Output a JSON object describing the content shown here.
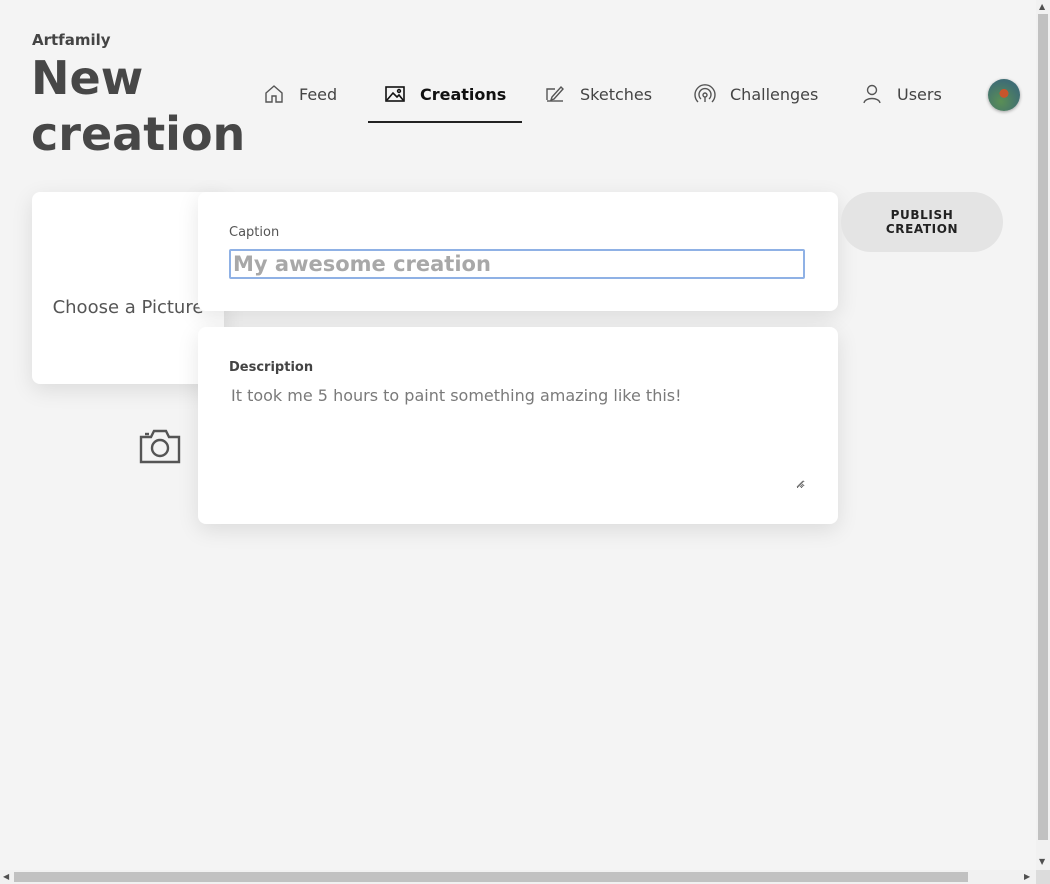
{
  "app": {
    "name": "Artfamily"
  },
  "page": {
    "title": "New creation"
  },
  "nav": {
    "items": [
      {
        "label": "Feed",
        "icon": "home-icon",
        "active": false
      },
      {
        "label": "Creations",
        "icon": "image-icon",
        "active": true
      },
      {
        "label": "Sketches",
        "icon": "sketch-icon",
        "active": false
      },
      {
        "label": "Challenges",
        "icon": "broadcast-icon",
        "active": false
      },
      {
        "label": "Users",
        "icon": "user-icon",
        "active": false
      }
    ],
    "avatar_icon": "user-avatar"
  },
  "picture": {
    "label": "Choose a Picture",
    "icon": "camera-icon"
  },
  "caption": {
    "label": "Caption",
    "placeholder": "My awesome creation",
    "value": ""
  },
  "description": {
    "label": "Description",
    "placeholder": "It took me 5 hours to paint something amazing like this!",
    "value": ""
  },
  "publish": {
    "label": "PUBLISH CREATION"
  },
  "colors": {
    "background": "#f4f4f4",
    "card": "#ffffff",
    "focus_border": "#8fb1e5",
    "publish_bg": "#e4e4e4"
  }
}
